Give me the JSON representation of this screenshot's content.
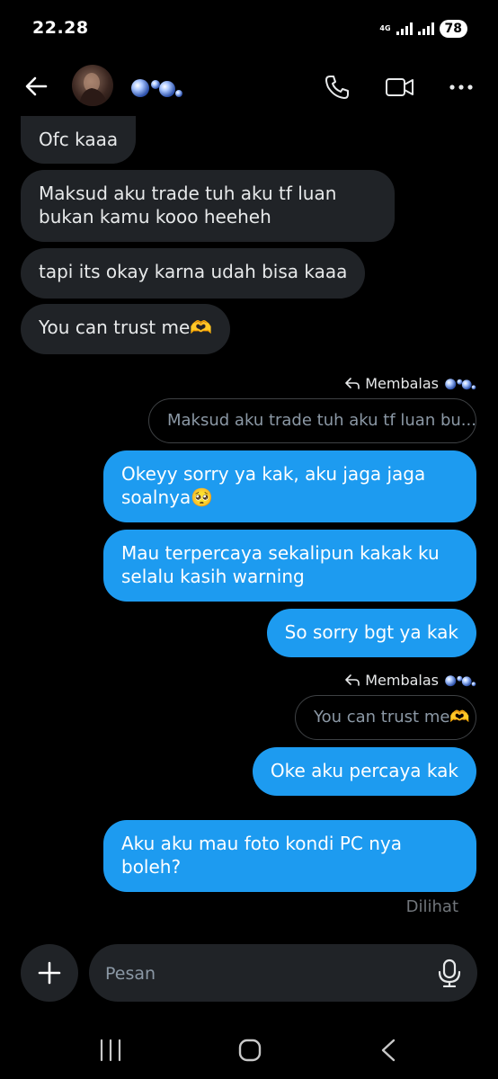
{
  "status_bar": {
    "time": "22.28",
    "network": "4G",
    "battery": "78"
  },
  "header": {
    "back_icon": "arrow-left-icon",
    "contact_name_icon": "bubbles-emoji",
    "call_icon": "phone-icon",
    "video_icon": "video-camera-icon",
    "more_icon": "more-dots-icon"
  },
  "messages": [
    {
      "dir": "in",
      "text": "Ofc kaaa"
    },
    {
      "dir": "in",
      "lines": [
        "Maksud aku trade tuh aku tf luan",
        "bukan kamu kooo heeheh"
      ]
    },
    {
      "dir": "in",
      "text": "tapi its okay karna udah bisa kaaa"
    },
    {
      "dir": "in",
      "text": "You can trust me🫶"
    },
    {
      "dir": "reply",
      "label": "Membalas",
      "quote": "Maksud aku trade tuh aku tf luan bu..."
    },
    {
      "dir": "out",
      "lines": [
        "Okeyy sorry ya kak, aku jaga jaga",
        "soalnya🥺"
      ]
    },
    {
      "dir": "out",
      "lines": [
        "Mau terpercaya sekalipun kakak ku",
        "selalu kasih warning"
      ]
    },
    {
      "dir": "out",
      "text": "So sorry bgt ya kak"
    },
    {
      "dir": "reply",
      "label": "Membalas",
      "quote": "You can trust me🫶"
    },
    {
      "dir": "out",
      "text": "Oke aku percaya kak"
    },
    {
      "dir": "out",
      "lines": [
        "Aku aku mau foto kondi PC nya",
        "boleh?"
      ]
    }
  ],
  "seen_label": "Dilihat",
  "composer": {
    "placeholder": "Pesan",
    "add_icon": "plus-icon",
    "mic_icon": "microphone-icon"
  },
  "nav_bar": {
    "recent_icon": "recent-apps-icon",
    "home_icon": "home-icon",
    "back_icon": "back-chevron-icon"
  },
  "colors": {
    "background": "#000000",
    "incoming_bubble": "#202327",
    "outgoing_bubble": "#1d9bf0",
    "muted_text": "#71767b"
  }
}
